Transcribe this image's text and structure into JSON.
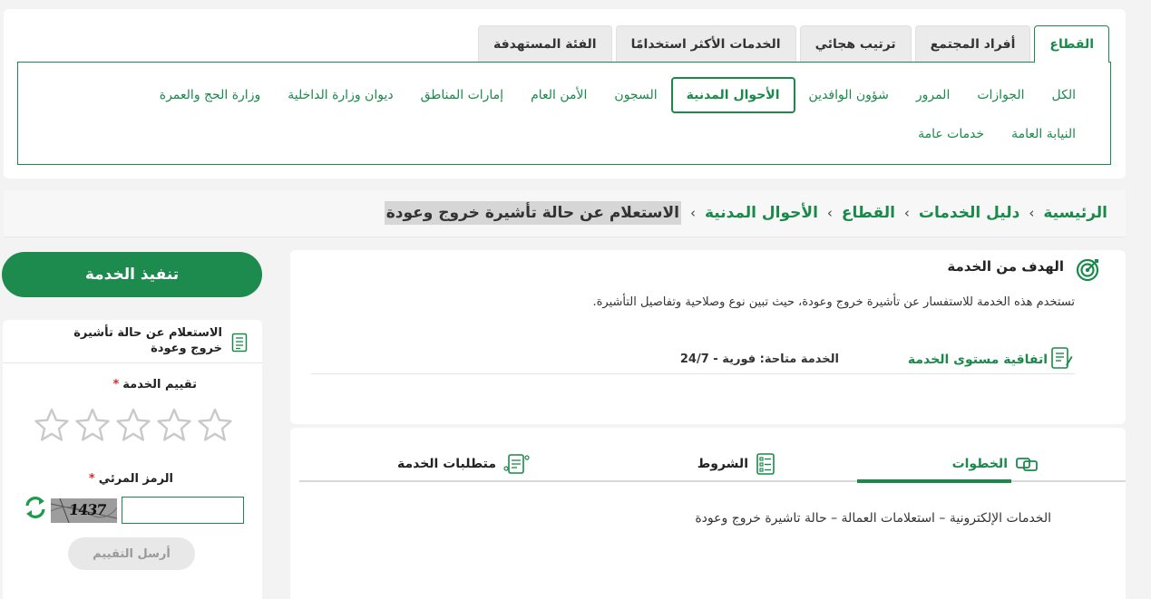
{
  "top_tabs": [
    "القطاع",
    "أفراد المجتمع",
    "ترتيب هجائي",
    "الخدمات الأكثر استخدامًا",
    "الفئة المستهدفة"
  ],
  "sectors_row1": [
    "الكل",
    "الجوازات",
    "المرور",
    "شؤون الوافدين",
    "الأحوال المدنية",
    "السجون",
    "الأمن العام",
    "إمارات المناطق",
    "ديوان وزارة الداخلية",
    "وزارة الحج والعمرة"
  ],
  "sectors_row2": [
    "النيابة العامة",
    "خدمات عامة"
  ],
  "active_sector": "الأحوال المدنية",
  "breadcrumb": {
    "home": "الرئيسية",
    "guide": "دليل الخدمات",
    "sector": "القطاع",
    "dept": "الأحوال المدنية",
    "current": "الاستعلام عن حالة تأشيرة خروج وعودة",
    "sep": "›"
  },
  "goal": {
    "title": "الهدف من الخدمة",
    "description": "تستخدم هذه الخدمة للاستفسار عن تأشيرة خروج وعودة، حيث تبين نوع وصلاحية وتفاصيل التأشيرة.",
    "sla_label": "اتفاقية مستوى الخدمة",
    "sla_value": "الخدمة متاحة: فورية - 24/7"
  },
  "steps": {
    "tab_steps": "الخطوات",
    "tab_conditions": "الشروط",
    "tab_requirements": "متطلبات الخدمة",
    "content": "الخدمات الإلكترونية – استعلامات العمالة – حالة تاشيرة خروج وعودة"
  },
  "execute_label": "تنفيذ الخدمة",
  "rating": {
    "title": "الاستعلام عن حالة تأشيرة خروج وعودة",
    "rating_label": "تقييم الخدمة",
    "required_mark": "*",
    "captcha_label": "الرمز المرئي",
    "captcha_value": "1437",
    "submit_label": "أرسل التقييم",
    "stars_selected": 0,
    "stars_total": 5
  },
  "colors": {
    "accent": "#1a8a4a",
    "button": "#1d8a4e"
  }
}
